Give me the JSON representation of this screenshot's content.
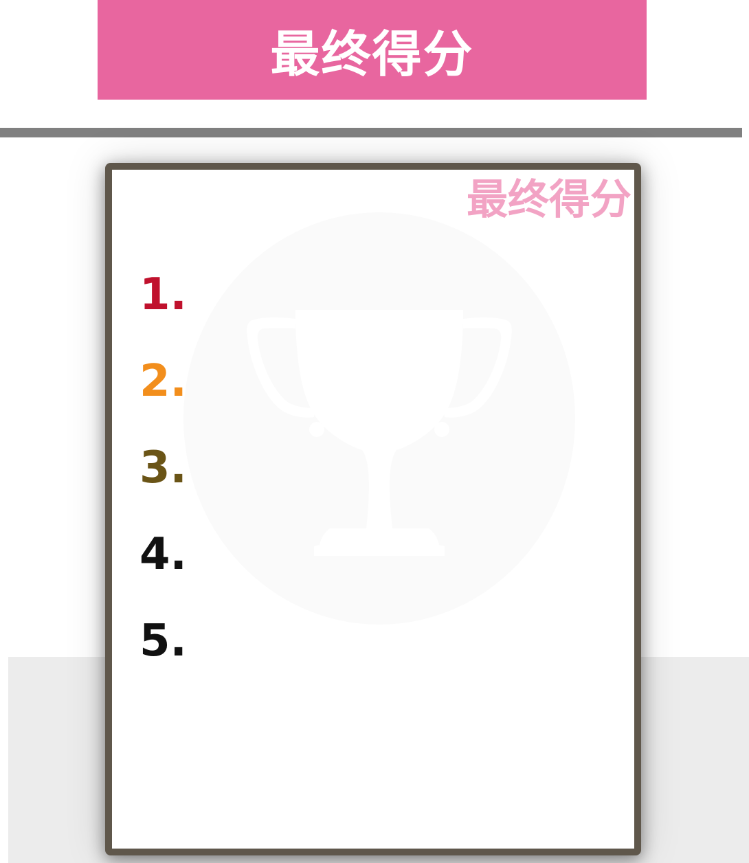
{
  "header": {
    "title": "最终得分"
  },
  "card": {
    "corner_title": "最终得分",
    "ranks": [
      {
        "label": "1.",
        "color": "#c0112d"
      },
      {
        "label": "2.",
        "color": "#f28e1c"
      },
      {
        "label": "3.",
        "color": "#6a5416"
      },
      {
        "label": "4.",
        "color": "#111111"
      },
      {
        "label": "5.",
        "color": "#111111"
      }
    ],
    "watermark_icon": "trophy-icon"
  },
  "colors": {
    "banner": "#e8669f",
    "card_border": "#5f574b",
    "corner_title": "#f2a3c4",
    "divider": "#808080"
  }
}
